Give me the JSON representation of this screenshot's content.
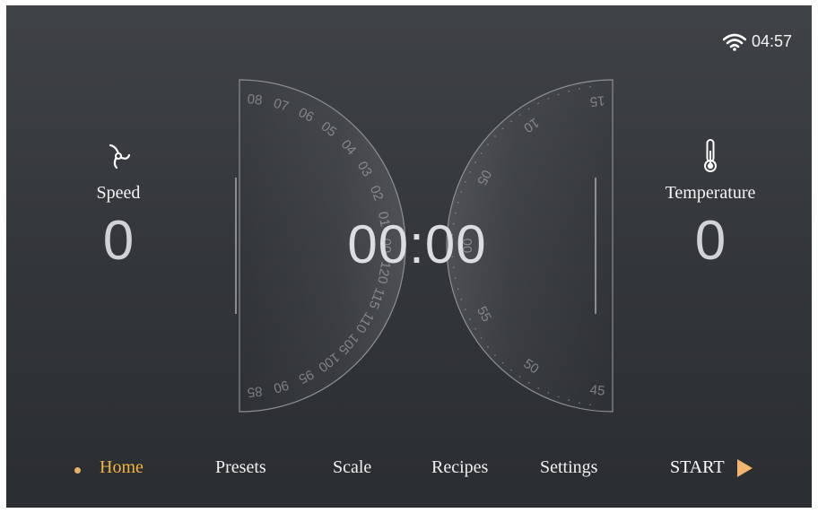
{
  "status": {
    "time": "04:57",
    "wifi_icon": "wifi-icon"
  },
  "speed": {
    "label": "Speed",
    "value": "0",
    "icon": "fan-icon"
  },
  "temperature": {
    "label": "Temperature",
    "value": "0",
    "icon": "thermometer-icon"
  },
  "timer": {
    "value": "00:00"
  },
  "left_dial": {
    "ticks": [
      "08",
      "07",
      "06",
      "05",
      "04",
      "03",
      "02",
      "01",
      "00",
      "120",
      "115",
      "110",
      "105",
      "100",
      "95",
      "90",
      "85"
    ]
  },
  "right_dial": {
    "ticks": [
      "15",
      "10",
      "05",
      "00",
      "55",
      "50",
      "45"
    ]
  },
  "nav": {
    "items": [
      "Home",
      "Presets",
      "Scale",
      "Recipes",
      "Settings"
    ],
    "active": "Home",
    "start_label": "START"
  },
  "colors": {
    "accent": "#f2b33d",
    "start_arrow": "#f3b66e",
    "background": "#34373b"
  }
}
